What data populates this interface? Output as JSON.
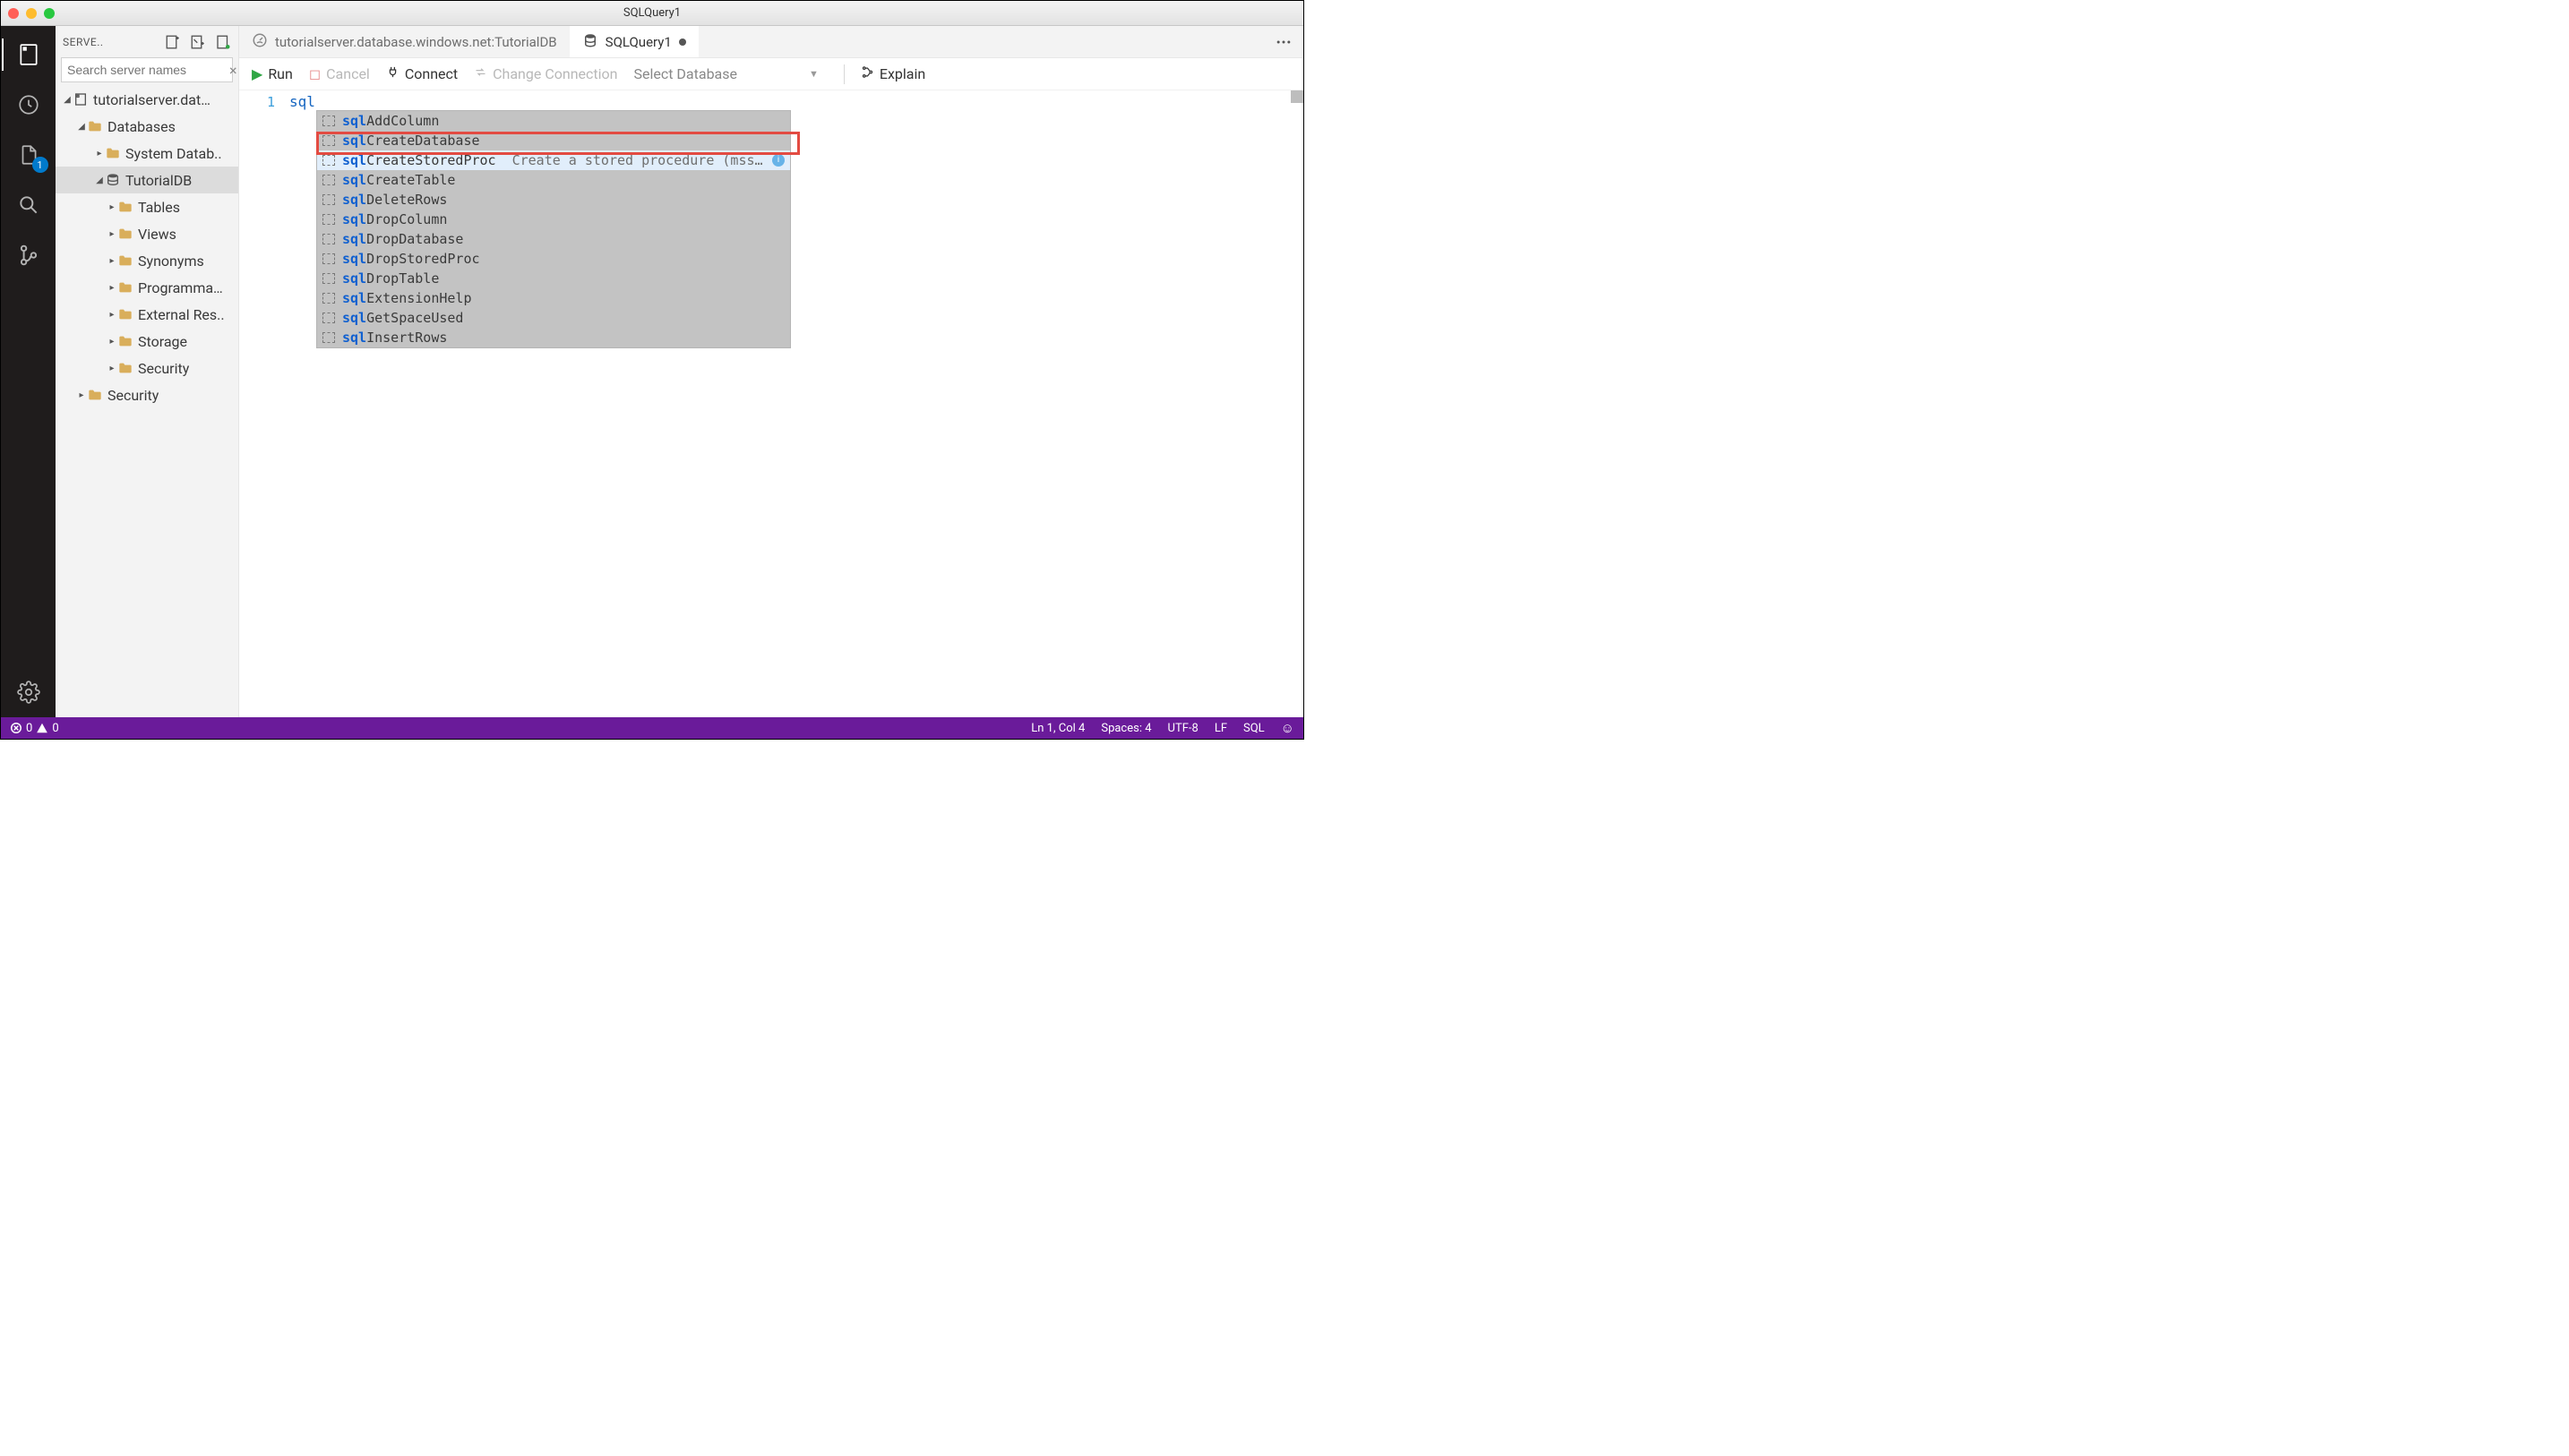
{
  "title": "SQLQuery1",
  "activity": {
    "items": [
      "servers",
      "tasks",
      "explorer",
      "search",
      "scm"
    ],
    "badge": "1",
    "settings": "settings"
  },
  "sidepanel": {
    "header": "SERVE..",
    "search_placeholder": "Search server names",
    "tree": {
      "server": "tutorialserver.dat…",
      "databases_label": "Databases",
      "system_db_label": "System Datab..",
      "tutorial_db": "TutorialDB",
      "tables": "Tables",
      "views": "Views",
      "synonyms": "Synonyms",
      "programma": "Programma…",
      "external_res": "External Res..",
      "storage": "Storage",
      "security_inner": "Security",
      "security_outer": "Security"
    }
  },
  "tabs": {
    "tab1": "tutorialserver.database.windows.net:TutorialDB",
    "tab2": "SQLQuery1"
  },
  "toolbar": {
    "run": "Run",
    "cancel": "Cancel",
    "connect": "Connect",
    "change_connection": "Change Connection",
    "select_db": "Select Database",
    "explain": "Explain"
  },
  "editor": {
    "line_number": "1",
    "typed": "sql"
  },
  "completion": {
    "prefix": "sql",
    "items": [
      {
        "rest": "AddColumn",
        "desc": ""
      },
      {
        "rest": "CreateDatabase",
        "desc": ""
      },
      {
        "rest": "CreateStoredProc",
        "desc": "Create a stored procedure (mssq…",
        "selected": true,
        "info": true
      },
      {
        "rest": "CreateTable",
        "desc": ""
      },
      {
        "rest": "DeleteRows",
        "desc": ""
      },
      {
        "rest": "DropColumn",
        "desc": ""
      },
      {
        "rest": "DropDatabase",
        "desc": ""
      },
      {
        "rest": "DropStoredProc",
        "desc": ""
      },
      {
        "rest": "DropTable",
        "desc": ""
      },
      {
        "rest": "ExtensionHelp",
        "desc": ""
      },
      {
        "rest": "GetSpaceUsed",
        "desc": ""
      },
      {
        "rest": "InsertRows",
        "desc": ""
      }
    ]
  },
  "statusbar": {
    "errors": "0",
    "warnings": "0",
    "ln_col": "Ln 1, Col 4",
    "spaces": "Spaces: 4",
    "encoding": "UTF-8",
    "eol": "LF",
    "lang": "SQL"
  }
}
